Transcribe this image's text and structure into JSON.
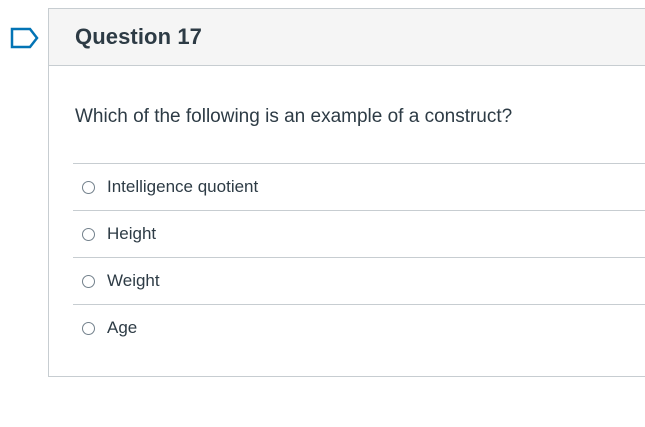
{
  "flag_icon": "bookmark-flag-icon",
  "accent_color": "#0374b5",
  "question": {
    "title": "Question 17",
    "text": "Which of the following is an example of a construct?",
    "answers": [
      {
        "label": "Intelligence quotient",
        "selected": false
      },
      {
        "label": "Height",
        "selected": false
      },
      {
        "label": "Weight",
        "selected": false
      },
      {
        "label": "Age",
        "selected": false
      }
    ]
  }
}
